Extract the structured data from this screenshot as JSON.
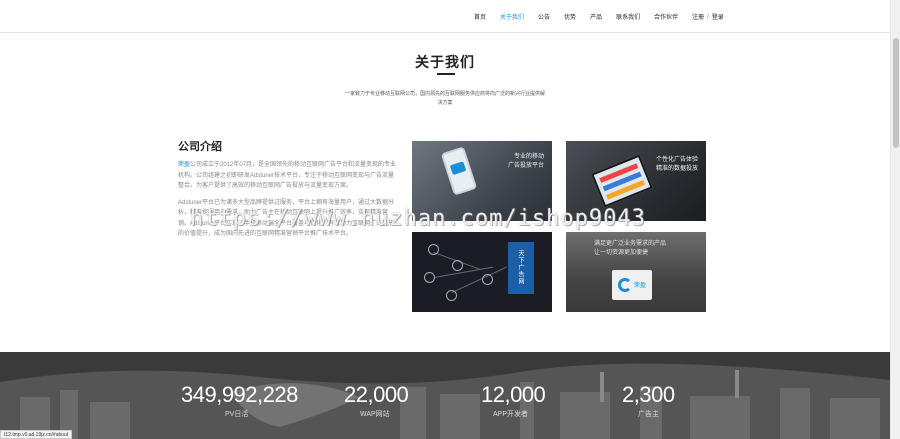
{
  "nav": {
    "items": [
      {
        "label": "首页",
        "active": false
      },
      {
        "label": "关于我们",
        "active": true
      },
      {
        "label": "公告",
        "active": false
      },
      {
        "label": "优势",
        "active": false
      },
      {
        "label": "产品",
        "active": false
      },
      {
        "label": "联系我们",
        "active": false
      },
      {
        "label": "合作伙伴",
        "active": false
      }
    ],
    "register": "注册",
    "separator": "/",
    "login": "登录"
  },
  "about": {
    "title": "关于我们",
    "intro": "一家致力于专业移动互联网公司，国内领先的互联网服务供应商将向广泛的新兴行业提供解决方案"
  },
  "company": {
    "title": "公司介绍",
    "brand": "荣盈",
    "para1": "公司成立于2012年07月，是全国领先的移动互联网广告平台和流量变现的专业机构。公司组建之初即研发Adstuner技术平台，专注于移动互联网变现与广告流量整合。为客户提供了高效的移动互联网广告投放与流量变现方案。",
    "para2": "Adstuner平台已为诸多大型品牌提供过服务，平台上拥有海量用户，通过大数据分析，精准挖掘用户需求，助力广告主在移动互联网上提升推广效率，实现精准营销。Adstuner平台实现了手机移动端全平台覆盖与优化，有效助力互联网广告投放的价值提升，成为国内先进的互联网精准营销平台推广技术平台。"
  },
  "tiles": [
    {
      "caption_1": "专业的移动",
      "caption_2": "广告投放平台"
    },
    {
      "caption_1": "个性化广告体验",
      "caption_2": "精准的数据投放"
    },
    {
      "sign": "天下广告网"
    },
    {
      "caption_1": "满足更广泛业务需求的产品",
      "caption_2": "让一切资源更加便捷",
      "logo": "荣盈"
    }
  ],
  "watermark": "https://www.huzhan.com/ishop9043",
  "stats": [
    {
      "value": "349,992,228",
      "label": "PV日活"
    },
    {
      "value": "22,000",
      "label": "WAP网站"
    },
    {
      "value": "12,000",
      "label": "APP开发者"
    },
    {
      "value": "2,300",
      "label": "广告主"
    }
  ],
  "status_url": "t12.tmp.v0.ad.19jz.cn/#about",
  "colors": {
    "accent": "#1a8fd8",
    "text": "#333333",
    "muted": "#888888"
  }
}
